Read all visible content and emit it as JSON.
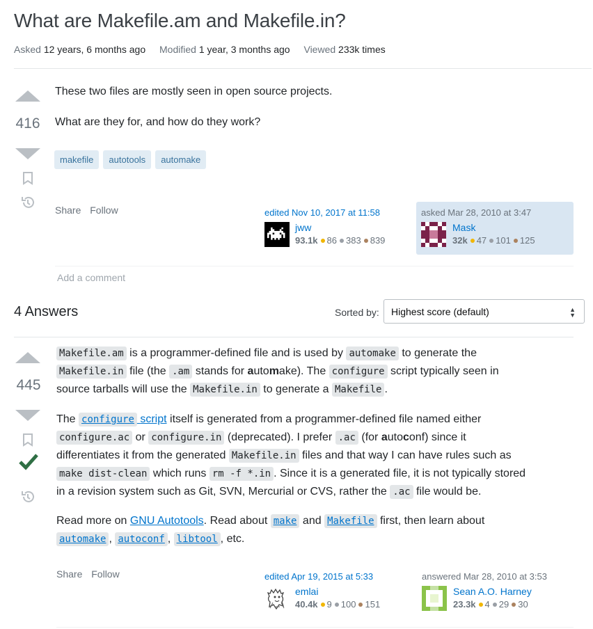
{
  "question": {
    "title": "What are Makefile.am and Makefile.in?",
    "asked_label": "Asked",
    "asked_value": "12 years, 6 months ago",
    "modified_label": "Modified",
    "modified_value": "1 year, 3 months ago",
    "viewed_label": "Viewed",
    "viewed_value": "233k times",
    "score": "416",
    "body_p1": "These two files are mostly seen in open source projects.",
    "body_p2": "What are they for, and how do they work?",
    "tags": [
      "makefile",
      "autotools",
      "automake"
    ],
    "share": "Share",
    "follow": "Follow",
    "editor": {
      "action": "edited Nov 10, 2017 at 11:58",
      "name": "jww",
      "rep": "93.1k",
      "gold": "86",
      "silver": "383",
      "bronze": "839"
    },
    "owner": {
      "action": "asked Mar 28, 2010 at 3:47",
      "name": "Mask",
      "rep": "32k",
      "gold": "47",
      "silver": "101",
      "bronze": "125",
      "bg": "#d9e6f2"
    },
    "add_comment": "Add a comment"
  },
  "answers_header": {
    "count_label": "4 Answers",
    "sorted_by": "Sorted by:",
    "sort_value": "Highest score (default)"
  },
  "answer": {
    "score": "445",
    "p1": {
      "c1": "Makefile.am",
      "t1": " is a programmer-defined file and is used by ",
      "c2": "automake",
      "t2": " to generate the",
      "c3": "Makefile.in",
      "t3": " file (the ",
      "c4": ".am",
      "t4": " stands for ",
      "b1": "a",
      "t5": "uto",
      "b2": "m",
      "t6": "ake). The ",
      "c5": "configure",
      "t7": " script typically seen in",
      "t8": "source tarballs will use the ",
      "c6": "Makefile.in",
      "t9": " to generate a ",
      "c7": "Makefile",
      "t10": "."
    },
    "p2": {
      "t1": "The ",
      "l1": "configure",
      "l2": "script",
      "t2": " itself is generated from a programmer-defined file named either",
      "c1": "configure.ac",
      "t3": " or ",
      "c2": "configure.in",
      "t4": " (deprecated). I prefer ",
      "c3": ".ac",
      "t5": " (for ",
      "b1": "a",
      "t6": "uto",
      "b2": "c",
      "t7": "onf) since it",
      "t8": "differentiates it from the generated ",
      "c4": "Makefile.in",
      "t9": " files and that way I can have rules such as",
      "c5": "make dist-clean",
      "t10": " which runs ",
      "c6": "rm -f *.in",
      "t11": ". Since it is a generated file, it is not typically stored",
      "t12": "in a revision system such as Git, SVN, Mercurial or CVS, rather the ",
      "c7": ".ac",
      "t13": " file would be."
    },
    "p3": {
      "t1": "Read more on ",
      "l1": "GNU Autotools",
      "t2": ". Read about ",
      "l2": "make",
      "t3": " and ",
      "l3": "Makefile",
      "t4": " first, then learn about",
      "l4": "automake",
      "t5": ", ",
      "l5": "autoconf",
      "t6": ", ",
      "l6": "libtool",
      "t7": ", etc."
    },
    "share": "Share",
    "follow": "Follow",
    "editor": {
      "action": "edited Apr 19, 2015 at 5:33",
      "name": "emlai",
      "rep": "40.4k",
      "gold": "9",
      "silver": "100",
      "bronze": "151"
    },
    "owner": {
      "action": "answered Mar 28, 2010 at 3:53",
      "name": "Sean A.O. Harney",
      "rep": "23.3k",
      "gold": "4",
      "silver": "29",
      "bronze": "30"
    }
  },
  "colors": {
    "accepted": "#2f6f44",
    "link": "#0074cc",
    "tag_bg": "#e1ecf4",
    "tag_fg": "#39739d"
  }
}
